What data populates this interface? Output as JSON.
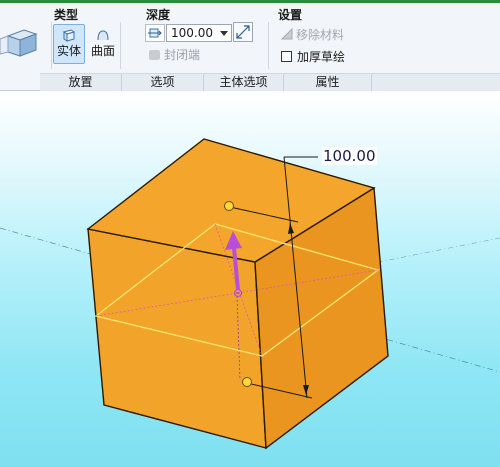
{
  "ribbon": {
    "type_group": {
      "title": "类型",
      "solid_label": "实体",
      "surface_label": "曲面"
    },
    "depth_group": {
      "title": "深度",
      "value": "100.00",
      "capped_ends_label": "封闭端"
    },
    "settings_group": {
      "title": "设置",
      "remove_material_label": "移除材料",
      "thicken_sketch_label": "加厚草绘"
    },
    "tabs": [
      "放置",
      "选项",
      "主体选项",
      "属性"
    ]
  },
  "viewport": {
    "dimension_value": "100.00"
  },
  "colors": {
    "cube_front": "#f2a32a",
    "cube_side": "#ea9520",
    "cube_top": "#f4a52c",
    "drag_arrow": "#b84fd8",
    "background": "#8ee6f4",
    "accent_green": "#2a8c3c"
  }
}
